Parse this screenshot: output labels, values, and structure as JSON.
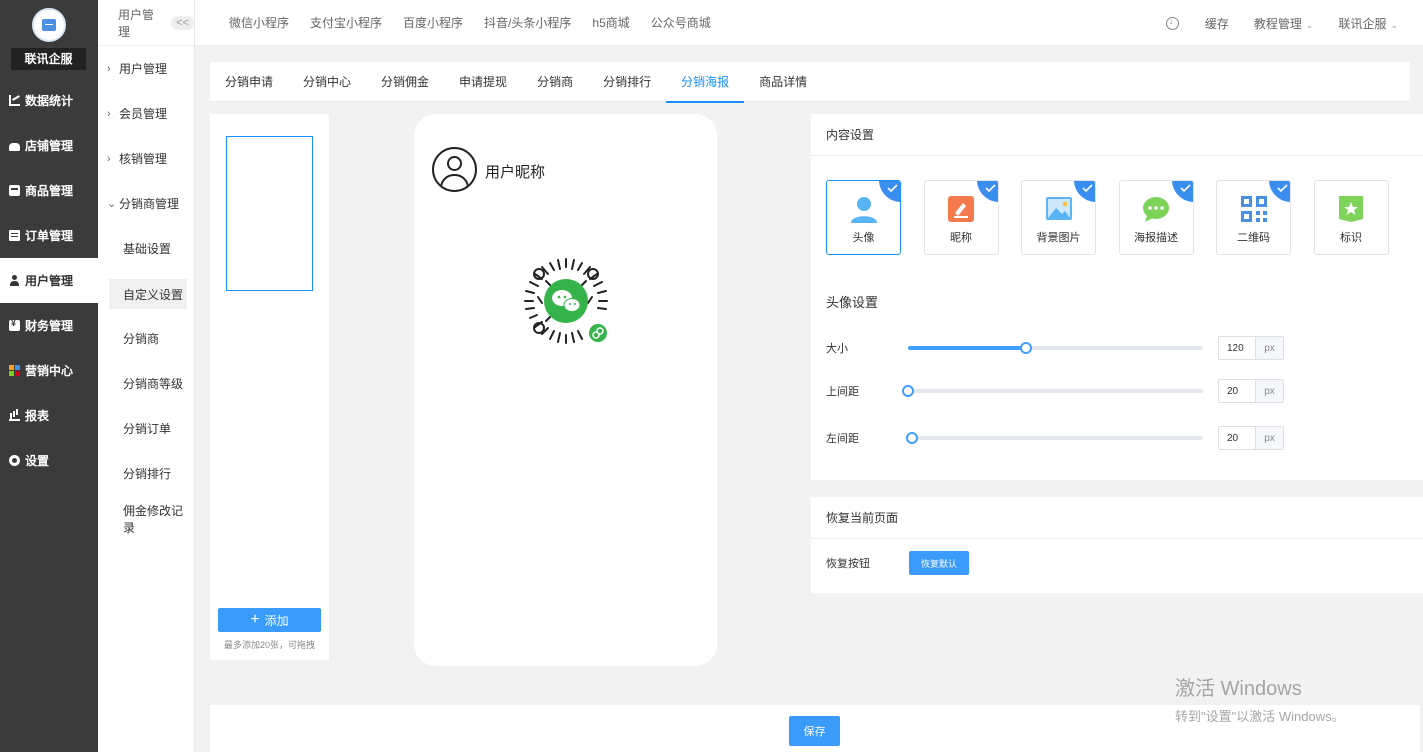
{
  "brand": {
    "name": "联讯企服"
  },
  "sidebar": {
    "items": [
      {
        "label": "数据统计",
        "icon": "chart-icon"
      },
      {
        "label": "店铺管理",
        "icon": "shop-icon"
      },
      {
        "label": "商品管理",
        "icon": "box-icon"
      },
      {
        "label": "订单管理",
        "icon": "list-icon"
      },
      {
        "label": "用户管理",
        "icon": "user-icon",
        "active": true
      },
      {
        "label": "财务管理",
        "icon": "money-icon"
      },
      {
        "label": "营销中心",
        "icon": "market-icon"
      },
      {
        "label": "报表",
        "icon": "report-icon"
      },
      {
        "label": "设置",
        "icon": "gear-icon"
      }
    ]
  },
  "submenu": {
    "title": "用户管理",
    "collapse": "<<",
    "groups": [
      {
        "label": "用户管理"
      },
      {
        "label": "会员管理"
      },
      {
        "label": "核销管理"
      },
      {
        "label": "分销商管理"
      }
    ],
    "children": [
      {
        "label": "基础设置"
      },
      {
        "label": "自定义设置",
        "active": true
      },
      {
        "label": "分销商"
      },
      {
        "label": "分销商等级"
      },
      {
        "label": "分销订单"
      },
      {
        "label": "分销排行"
      },
      {
        "label": "佣金修改记录"
      }
    ]
  },
  "topbar": {
    "links": [
      "微信小程序",
      "支付宝小程序",
      "百度小程序",
      "抖音/头条小程序",
      "h5商城",
      "公众号商城"
    ],
    "cache": "缓存",
    "tutorial": "教程管理",
    "user": "联讯企服"
  },
  "tabs": [
    "分销申请",
    "分销中心",
    "分销佣金",
    "申请提现",
    "分销商",
    "分销排行",
    "分销海报",
    "商品详情"
  ],
  "active_tab": "分销海报",
  "bg_panel": {
    "add_label": "添加",
    "tip": "最多添加20张，可拖拽"
  },
  "preview": {
    "nickname": "用户昵称"
  },
  "content_settings": {
    "title": "内容设置",
    "options": [
      {
        "label": "头像",
        "checked": true,
        "selected": true,
        "icon": "avatar-option-icon"
      },
      {
        "label": "昵称",
        "checked": true,
        "icon": "nickname-option-icon"
      },
      {
        "label": "背景图片",
        "checked": true,
        "icon": "image-option-icon"
      },
      {
        "label": "海报描述",
        "checked": true,
        "icon": "chat-option-icon"
      },
      {
        "label": "二维码",
        "checked": true,
        "icon": "qrcode-option-icon"
      },
      {
        "label": "标识",
        "checked": false,
        "icon": "badge-option-icon"
      }
    ],
    "avatar_title": "头像设置",
    "sliders": [
      {
        "label": "大小",
        "value": "120",
        "unit": "px",
        "fraction": 0.4
      },
      {
        "label": "上间距",
        "value": "20",
        "unit": "px",
        "fraction": 0.0
      },
      {
        "label": "左间距",
        "value": "20",
        "unit": "px",
        "fraction": 0.015
      }
    ]
  },
  "restore": {
    "title": "恢复当前页面",
    "label": "恢复按钮",
    "button": "恢复默认"
  },
  "footer": {
    "save": "保存"
  },
  "watermark": {
    "line1": "激活 Windows",
    "line2": "转到\"设置\"以激活 Windows。"
  },
  "colors": {
    "accent": "#1890ff",
    "button": "#3a9bfa",
    "sidebar": "#3b3b3b"
  }
}
